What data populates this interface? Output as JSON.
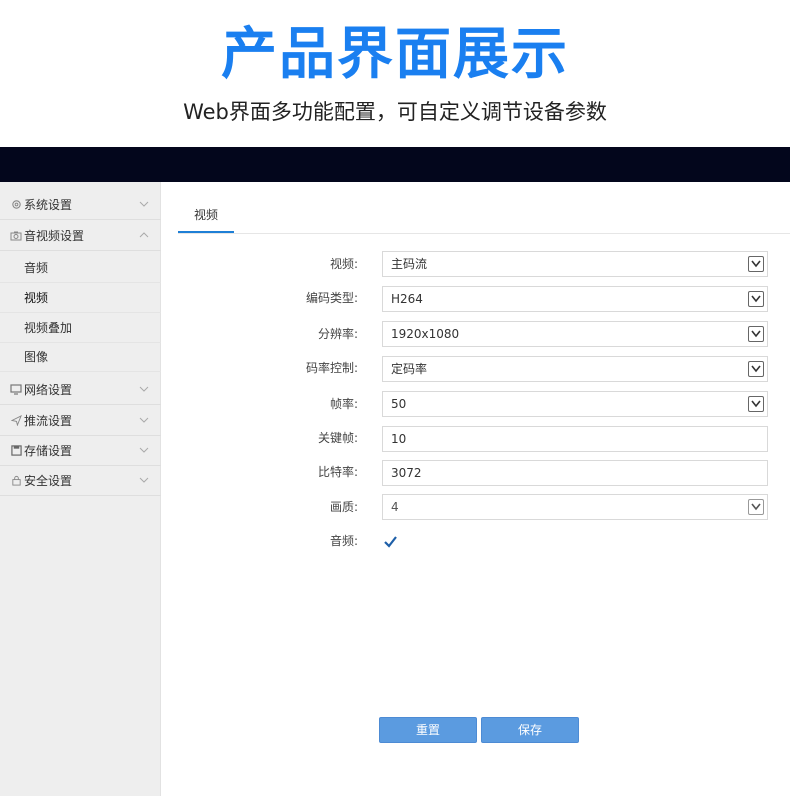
{
  "promo": {
    "title": "产品界面展示",
    "subtitle": "Web界面多功能配置，可自定义调节设备参数"
  },
  "sidebar": {
    "groups": [
      {
        "label": "系统设置",
        "icon": "gear-icon",
        "expanded": false
      },
      {
        "label": "音视频设置",
        "icon": "camera-icon",
        "expanded": true
      },
      {
        "label": "网络设置",
        "icon": "monitor-icon",
        "expanded": false
      },
      {
        "label": "推流设置",
        "icon": "send-icon",
        "expanded": false
      },
      {
        "label": "存储设置",
        "icon": "save-icon",
        "expanded": false
      },
      {
        "label": "安全设置",
        "icon": "lock-icon",
        "expanded": false
      }
    ],
    "sub_items": [
      {
        "label": "音频",
        "active": false
      },
      {
        "label": "视频",
        "active": true
      },
      {
        "label": "视频叠加",
        "active": false
      },
      {
        "label": "图像",
        "active": false
      }
    ]
  },
  "tab": {
    "label": "视频"
  },
  "form": {
    "fields": [
      {
        "label": "视频:",
        "value": "主码流",
        "type": "select"
      },
      {
        "label": "编码类型:",
        "value": "H264",
        "type": "select"
      },
      {
        "label": "分辨率:",
        "value": "1920x1080",
        "type": "select"
      },
      {
        "label": "码率控制:",
        "value": "定码率",
        "type": "select"
      },
      {
        "label": "帧率:",
        "value": "50",
        "type": "select"
      },
      {
        "label": "关键帧:",
        "value": "10",
        "type": "text"
      },
      {
        "label": "比特率:",
        "value": "3072",
        "type": "text"
      },
      {
        "label": "画质:",
        "value": "4",
        "type": "select"
      }
    ],
    "audio": {
      "label": "音频:",
      "checked": true
    }
  },
  "buttons": {
    "reset": "重置",
    "save": "保存"
  },
  "colors": {
    "accent": "#1e7fd6",
    "title_blue": "#1a7ff0",
    "button": "#5b9be0",
    "topbar": "#03061c"
  }
}
